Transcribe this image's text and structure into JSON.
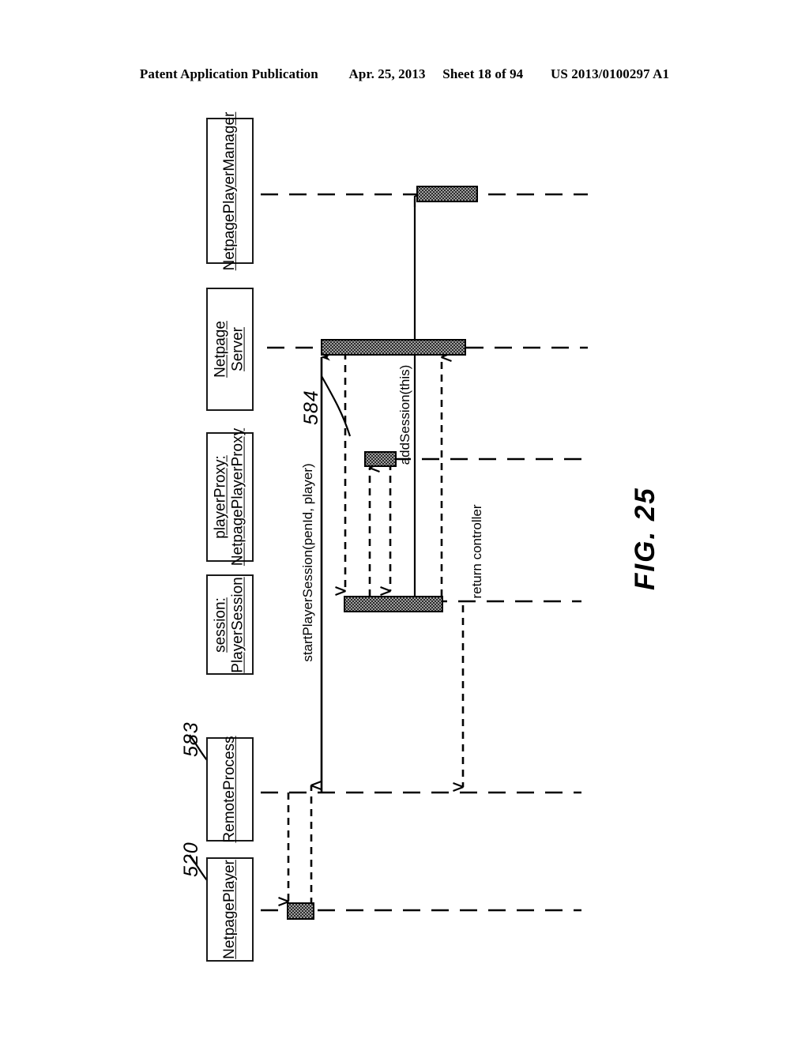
{
  "header": {
    "publication": "Patent Application Publication",
    "date": "Apr. 25, 2013",
    "sheet": "Sheet 18 of 94",
    "patent_number": "US 2013/0100297 A1"
  },
  "figure": {
    "label": "FIG. 25",
    "type": "uml-sequence-diagram"
  },
  "participants": [
    {
      "id": "netpage-player-manager",
      "name": "NetpagePlayerManager",
      "lines": [
        "NetpagePlayerManager"
      ]
    },
    {
      "id": "netpage-server",
      "name": "Netpage Server",
      "lines": [
        "Netpage",
        "Server"
      ]
    },
    {
      "id": "player-proxy",
      "name": "playerProxy: NetpagePlayerProxy",
      "lines": [
        "playerProxy:",
        "NetpagePlayerProxy"
      ]
    },
    {
      "id": "session",
      "name": "session: PlayerSession",
      "lines": [
        "session:",
        "PlayerSession"
      ]
    },
    {
      "id": "remote-process",
      "name": "RemoteProcess",
      "lines": [
        "RemoteProcess"
      ]
    },
    {
      "id": "netpage-player",
      "name": "NetpagePlayer",
      "lines": [
        "NetpagePlayer"
      ]
    }
  ],
  "messages": [
    {
      "id": "start-player-session",
      "label": "startPlayerSession(penId, player)"
    },
    {
      "id": "add-session",
      "label": "addSession(this)"
    },
    {
      "id": "return-controller",
      "label": "return controller"
    }
  ],
  "reference_numerals": [
    {
      "id": "ref-520",
      "value": "520"
    },
    {
      "id": "ref-583",
      "value": "583"
    },
    {
      "id": "ref-584",
      "value": "584"
    }
  ],
  "colors": {
    "ink": "#000000",
    "background": "#ffffff",
    "activation_fill": "#3a3a3a"
  }
}
